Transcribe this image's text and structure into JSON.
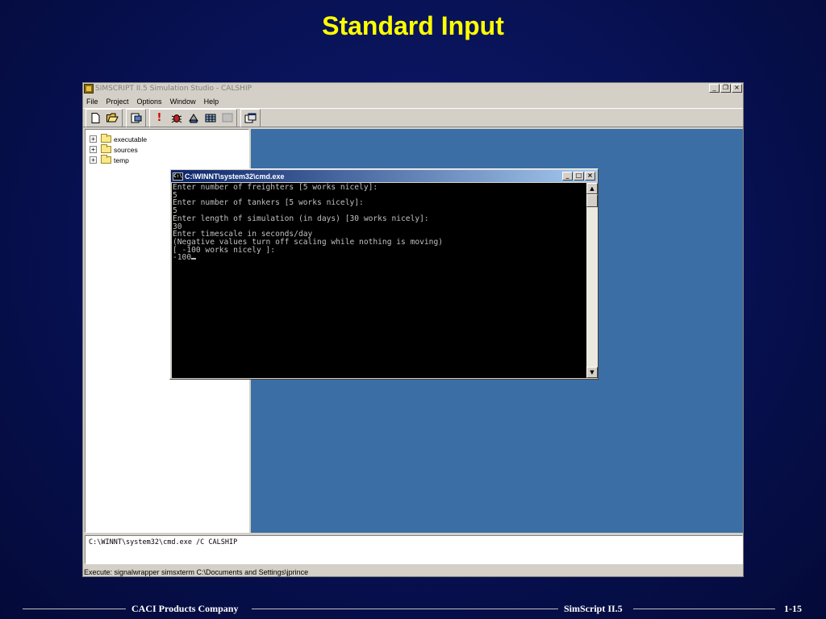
{
  "slide": {
    "title": "Standard Input",
    "footer_left": "CACI Products Company",
    "footer_center": "SimScript II.5",
    "footer_right": "1-15"
  },
  "app": {
    "title": "SIMSCRIPT II.5 Simulation Studio - CALSHIP",
    "menu": [
      "File",
      "Project",
      "Options",
      "Window",
      "Help"
    ],
    "toolbar_icons": [
      "new-file-icon",
      "open-folder-icon",
      "compile-icon",
      "exclamation-icon",
      "debug-bug-icon",
      "build-icon",
      "grid-icon",
      "disabled-tool-icon",
      "window-icon"
    ],
    "tree": [
      {
        "label": "executable"
      },
      {
        "label": "sources"
      },
      {
        "label": "temp"
      }
    ],
    "output_text": "C:\\WINNT\\system32\\cmd.exe /C CALSHIP",
    "status_text": "Execute: signalwrapper simsxterm C:\\Documents and Settings\\jprince"
  },
  "cmd": {
    "title": "C:\\WINNT\\system32\\cmd.exe",
    "lines": [
      "Enter number of freighters [5 works nicely]:",
      "5",
      "Enter number of tankers [5 works nicely]:",
      "5",
      "Enter length of simulation (in days) [30 works nicely]:",
      "30",
      "Enter timescale in seconds/day",
      "(Negative values turn off scaling while nothing is moving)",
      "[ -100 works nicely ]:",
      "-100"
    ]
  },
  "colors": {
    "title": "#ffff00",
    "desktop": "#3a6ea5",
    "background": "#07104f"
  }
}
